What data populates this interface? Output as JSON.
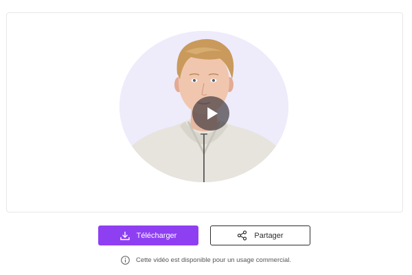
{
  "video": {
    "play_icon": "play-icon",
    "avatar_background_color": "#eeebfb",
    "avatar_description": "avatar-presenter"
  },
  "actions": {
    "download_label": "Télécharger",
    "download_icon": "download-icon",
    "download_color": "#8f3ff2",
    "share_label": "Partager",
    "share_icon": "share-icon"
  },
  "notice": {
    "icon": "info-icon",
    "text": "Cette vidéo est disponible pour un usage commercial."
  }
}
